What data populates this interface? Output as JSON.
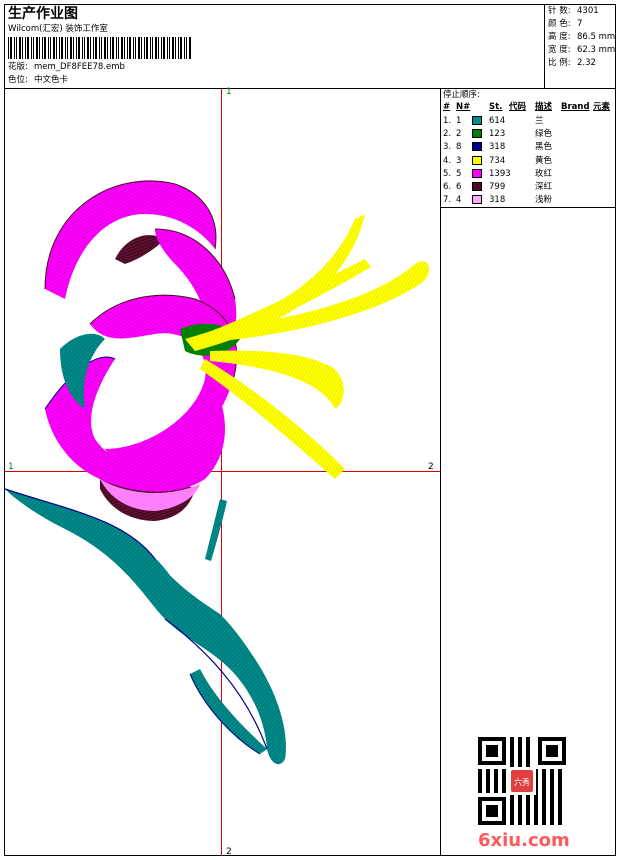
{
  "header": {
    "title": "生产作业图",
    "studio": "Wilcom(汇宏) 装饰工作室",
    "design_label": "花版:",
    "design_value": "mem_DF8FEE78.emb",
    "color_label": "色位:",
    "color_value": "中文色卡"
  },
  "stats": [
    {
      "label": "针 数:",
      "value": "4301"
    },
    {
      "label": "颜 色:",
      "value": "7"
    },
    {
      "label": "高 度:",
      "value": "86.5 mm"
    },
    {
      "label": "宽 度:",
      "value": "62.3 mm"
    },
    {
      "label": "比 例:",
      "value": "2.32"
    }
  ],
  "stop_sequence": {
    "title": "停止顺序:",
    "columns": [
      "#",
      "N#",
      "St.",
      "代码",
      "描述",
      "Brand",
      "元素"
    ],
    "rows": [
      {
        "idx": "1.",
        "n": "1",
        "color": "#008b8b",
        "st": "614",
        "desc": "兰"
      },
      {
        "idx": "2.",
        "n": "2",
        "color": "#008000",
        "st": "123",
        "desc": "绿色"
      },
      {
        "idx": "3.",
        "n": "8",
        "color": "#00008b",
        "st": "318",
        "desc": "黑色"
      },
      {
        "idx": "4.",
        "n": "3",
        "color": "#ffff00",
        "st": "734",
        "desc": "黄色"
      },
      {
        "idx": "5.",
        "n": "5",
        "color": "#ff00ff",
        "st": "1393",
        "desc": "玫红"
      },
      {
        "idx": "6.",
        "n": "6",
        "color": "#4b0a1e",
        "st": "799",
        "desc": "深红"
      },
      {
        "idx": "7.",
        "n": "4",
        "color": "#ffa8ff",
        "st": "318",
        "desc": "浅粉"
      }
    ]
  },
  "axes": {
    "top": "1",
    "bottom": "2",
    "left": "1",
    "right": "2"
  },
  "watermark": "6xiu.com",
  "seal_text": "六秀"
}
